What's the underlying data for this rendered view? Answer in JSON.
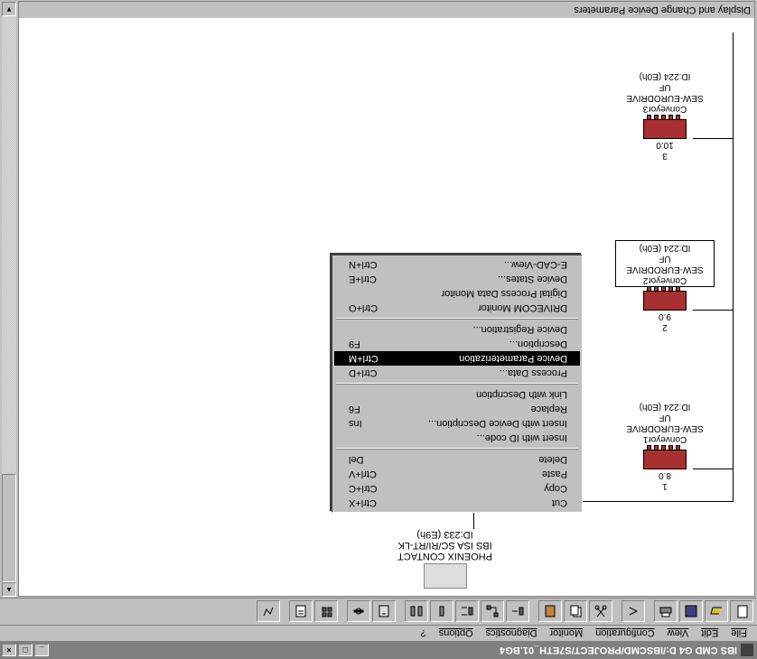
{
  "window": {
    "title": "IBS CMD G4 D:/IBSCMD/PROJECT/S7ETH_01.BG4"
  },
  "menubar": {
    "items": [
      "File",
      "Edit",
      "View",
      "Configuration",
      "Monitor",
      "Diagnostics",
      "Options",
      "?"
    ]
  },
  "subwindow": {
    "title": "Display and Change Device Parameters"
  },
  "root_device": {
    "name": "PHOENIX CONTACT",
    "type": "IBS ISA SC/RI/RT-LK",
    "id": "ID:233 (E9h)"
  },
  "devices": [
    {
      "slot": "1",
      "addr": "8.0",
      "name": "Conveyor1",
      "make": "SEW-EURODRIVE",
      "model": "UF",
      "id": "ID:224 (E0h)",
      "boxed": false
    },
    {
      "slot": "2",
      "addr": "9.0",
      "name": "Conveyor2",
      "make": "SEW-EURODRIVE",
      "model": "UF",
      "id": "ID:224 (E0h)",
      "boxed": true
    },
    {
      "slot": "3",
      "addr": "10.0",
      "name": "Conveyor3",
      "make": "SEW-EURODRIVE",
      "model": "UF",
      "id": "ID:224 (E0h)",
      "boxed": false
    }
  ],
  "context_menu": {
    "groups": [
      [
        {
          "label": "Cut",
          "shortcut": "Ctrl+X"
        },
        {
          "label": "Copy",
          "shortcut": "Ctrl+C"
        },
        {
          "label": "Paste",
          "shortcut": "Ctrl+V"
        },
        {
          "label": "Delete",
          "shortcut": "Del"
        }
      ],
      [
        {
          "label": "Insert with ID code...",
          "shortcut": ""
        },
        {
          "label": "Insert with Device Description...",
          "shortcut": "Ins"
        },
        {
          "label": "Replace",
          "shortcut": "F6"
        },
        {
          "label": "Link with Description",
          "shortcut": ""
        }
      ],
      [
        {
          "label": "Process Data...",
          "shortcut": "Ctrl+D"
        },
        {
          "label": "Device Parameterization",
          "shortcut": "Ctrl+M",
          "highlight": true
        },
        {
          "label": "Description...",
          "shortcut": "F9"
        },
        {
          "label": "Device Registration...",
          "shortcut": ""
        }
      ],
      [
        {
          "label": "DRIVECOM Monitor",
          "shortcut": "Ctrl+O"
        },
        {
          "label": "Digital Process Data Monitor",
          "shortcut": ""
        },
        {
          "label": "Device States...",
          "shortcut": "Ctrl+E"
        },
        {
          "label": "E-CAD-View...",
          "shortcut": "Ctrl+N"
        }
      ]
    ]
  }
}
